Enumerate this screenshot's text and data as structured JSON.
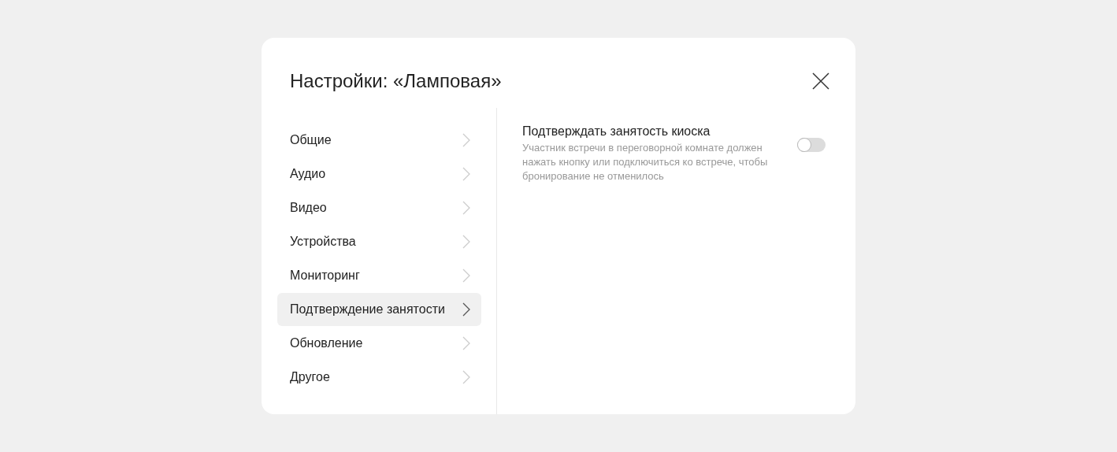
{
  "dialog": {
    "title": "Настройки: «Ламповая»"
  },
  "sidebar": {
    "items": [
      {
        "label": "Общие",
        "selected": false
      },
      {
        "label": "Аудио",
        "selected": false
      },
      {
        "label": "Видео",
        "selected": false
      },
      {
        "label": "Устройства",
        "selected": false
      },
      {
        "label": "Мониторинг",
        "selected": false
      },
      {
        "label": "Подтверждение занятости",
        "selected": true
      },
      {
        "label": "Обновление",
        "selected": false
      },
      {
        "label": "Другое",
        "selected": false
      }
    ]
  },
  "settings": [
    {
      "title": "Подтверждать занятость киоска",
      "description": "Участник встречи в переговорной комнате должен нажать кнопку или подключиться ко встрече, чтобы бронирование не отменилось",
      "on": false
    }
  ]
}
